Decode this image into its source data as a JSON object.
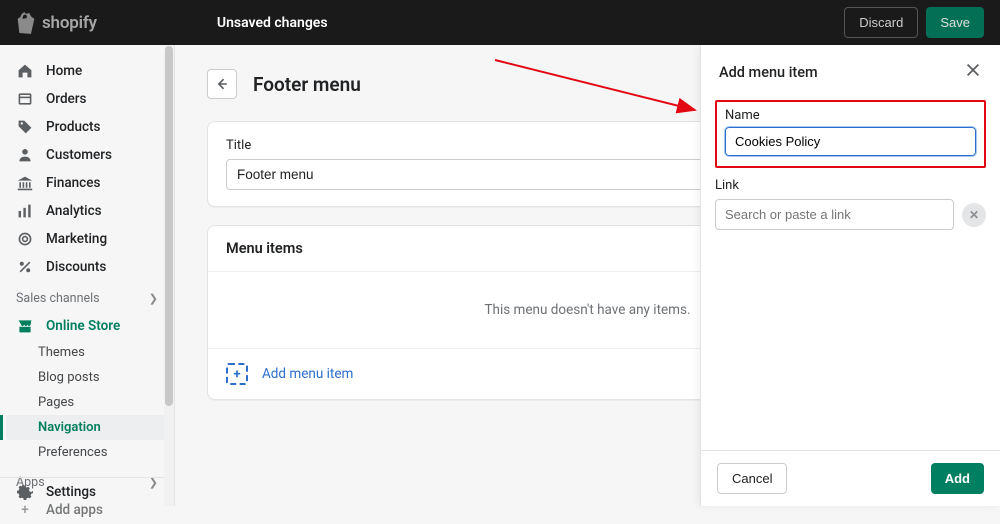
{
  "brand": "shopify",
  "topbar": {
    "unsaved": "Unsaved changes",
    "discard": "Discard",
    "save": "Save"
  },
  "sidebar": {
    "items": [
      {
        "label": "Home"
      },
      {
        "label": "Orders"
      },
      {
        "label": "Products"
      },
      {
        "label": "Customers"
      },
      {
        "label": "Finances"
      },
      {
        "label": "Analytics"
      },
      {
        "label": "Marketing"
      },
      {
        "label": "Discounts"
      }
    ],
    "channels_label": "Sales channels",
    "online_store": "Online Store",
    "subs": [
      {
        "label": "Themes"
      },
      {
        "label": "Blog posts"
      },
      {
        "label": "Pages"
      },
      {
        "label": "Navigation"
      },
      {
        "label": "Preferences"
      }
    ],
    "apps_label": "Apps",
    "add_apps": "Add apps",
    "settings": "Settings"
  },
  "page": {
    "title": "Footer menu",
    "title_field_label": "Title",
    "title_value": "Footer menu",
    "menu_items_title": "Menu items",
    "empty": "This menu doesn't have any items.",
    "add_menu_item": "Add menu item"
  },
  "panel": {
    "title": "Add menu item",
    "name_label": "Name",
    "name_value": "Cookies Policy",
    "link_label": "Link",
    "link_placeholder": "Search or paste a link",
    "cancel": "Cancel",
    "add": "Add"
  }
}
